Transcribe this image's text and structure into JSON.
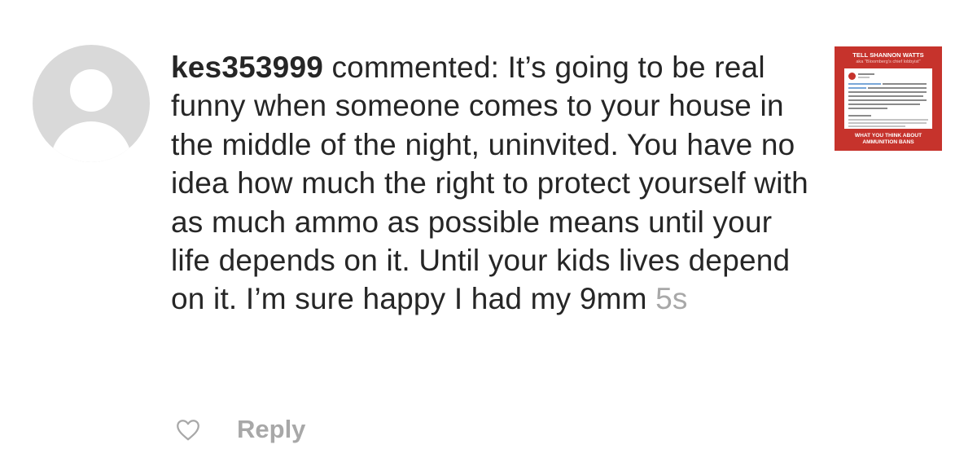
{
  "comment": {
    "username": "kes353999",
    "verb": " commented: ",
    "text": "It’s going to be real funny when someone comes to your house in the middle of the night, uninvited. You have no idea how much the right to protect yourself with as much ammo as possible means until your life depends on it. Until your kids lives depend on it. I’m sure happy I had my 9mm",
    "timestamp": "5s"
  },
  "actions": {
    "like_icon": "heart-outline-icon",
    "reply_label": "Reply"
  },
  "post_thumbnail": {
    "title": "TELL SHANNON WATTS",
    "subtitle": "aka \"Bloomberg's chief lobbyist\"",
    "footer_line1": "WHAT YOU THINK ABOUT",
    "footer_line2": "AMMUNITION BANS",
    "background_color": "#c6332c"
  },
  "colors": {
    "text": "#262626",
    "secondary_text": "#a8a8a8",
    "avatar_placeholder": "#d9d9d9"
  }
}
